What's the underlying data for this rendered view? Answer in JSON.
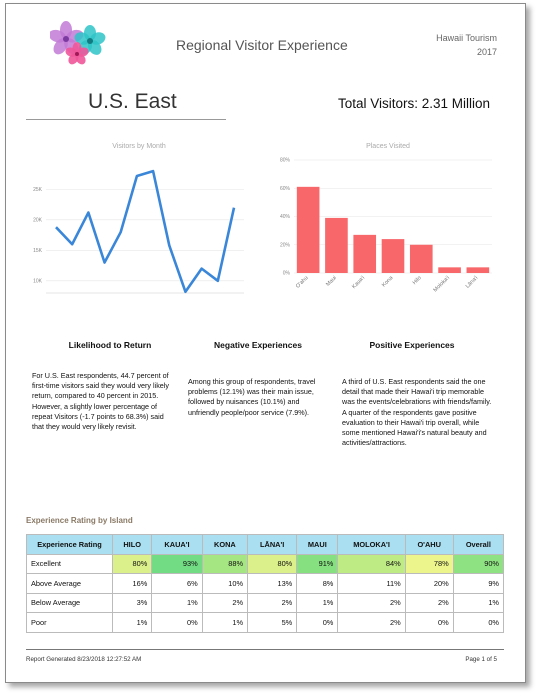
{
  "header": {
    "title": "Regional Visitor Experience",
    "org": "Hawaii Tourism",
    "year": "2017"
  },
  "region": {
    "name": "U.S. East",
    "total_visitors": "Total Visitors: 2.31 Million"
  },
  "colors": {
    "line": "#3a86d8",
    "bar": "#f8686b",
    "table_header": "#a9dff0"
  },
  "chart_data": [
    {
      "type": "line",
      "title": "Visitors by Month",
      "xlabel": "",
      "ylabel": "",
      "y_ticks": [
        "10K",
        "15K",
        "20K",
        "25K"
      ],
      "ylim": [
        8000,
        29000
      ],
      "x": [
        1,
        2,
        3,
        4,
        5,
        6,
        7,
        8,
        9,
        10,
        11,
        12
      ],
      "values": [
        18800,
        16000,
        21200,
        13000,
        18000,
        27200,
        28000,
        15800,
        8200,
        12000,
        10000,
        22000
      ],
      "grid": true
    },
    {
      "type": "bar",
      "title": "Places Visited",
      "categories": [
        "O'ahu",
        "Maui",
        "Kaua'i",
        "Kona",
        "Hilo",
        "Moloka'i",
        "Lāna'i"
      ],
      "values": [
        61,
        39,
        27,
        24,
        20,
        4,
        4
      ],
      "y_ticks": [
        "0%",
        "20%",
        "40%",
        "60%",
        "80%"
      ],
      "ylim": [
        0,
        80
      ],
      "grid": true
    }
  ],
  "sections": [
    {
      "heading": "Likelihood to Return",
      "body": "For U.S. East respondents, 44.7 percent of first-time visitors said they would very likely return, compared to 40 percent in 2015. However, a slightly lower percentage of repeat Visitors (-1.7 points to 68.3%) said that they would very likely revisit."
    },
    {
      "heading": "Negative Experiences",
      "body": "Among this group of respondents, travel problems (12.1%) was their main issue, followed by nuisances (10.1%) and unfriendly people/poor service (7.9%)."
    },
    {
      "heading": "Positive Experiences",
      "body": "A third of U.S. East respondents said the one detail that made their Hawai'i trip memorable was the events/celebrations with friends/family. A quarter of the respondents gave positive evaluation to their Hawai'i trip overall, while some mentioned Hawai'i's natural beauty and activities/attractions."
    }
  ],
  "rating": {
    "title": "Experience Rating by Island",
    "headers": [
      "Experience Rating",
      "HILO",
      "KAUA'I",
      "KONA",
      "LĀNA'I",
      "MAUI",
      "MOLOKA'I",
      "O'AHU",
      "Overall"
    ],
    "rows": [
      {
        "label": "Excellent",
        "values": [
          "80%",
          "93%",
          "88%",
          "80%",
          "91%",
          "84%",
          "78%",
          "90%"
        ],
        "fills": [
          "#dbf08a",
          "#72dc84",
          "#a6e682",
          "#dbf08a",
          "#86e080",
          "#bfeb85",
          "#ecf58c",
          "#8fe282"
        ]
      },
      {
        "label": "Above Average",
        "values": [
          "16%",
          "6%",
          "10%",
          "13%",
          "8%",
          "11%",
          "20%",
          "9%"
        ]
      },
      {
        "label": "Below Average",
        "values": [
          "3%",
          "1%",
          "2%",
          "2%",
          "1%",
          "2%",
          "2%",
          "1%"
        ]
      },
      {
        "label": "Poor",
        "values": [
          "1%",
          "0%",
          "1%",
          "5%",
          "0%",
          "2%",
          "0%",
          "0%"
        ]
      }
    ]
  },
  "footer": {
    "generated": "Report Generated 8/23/2018 12:27:52 AM",
    "page": "Page 1 of 5"
  }
}
